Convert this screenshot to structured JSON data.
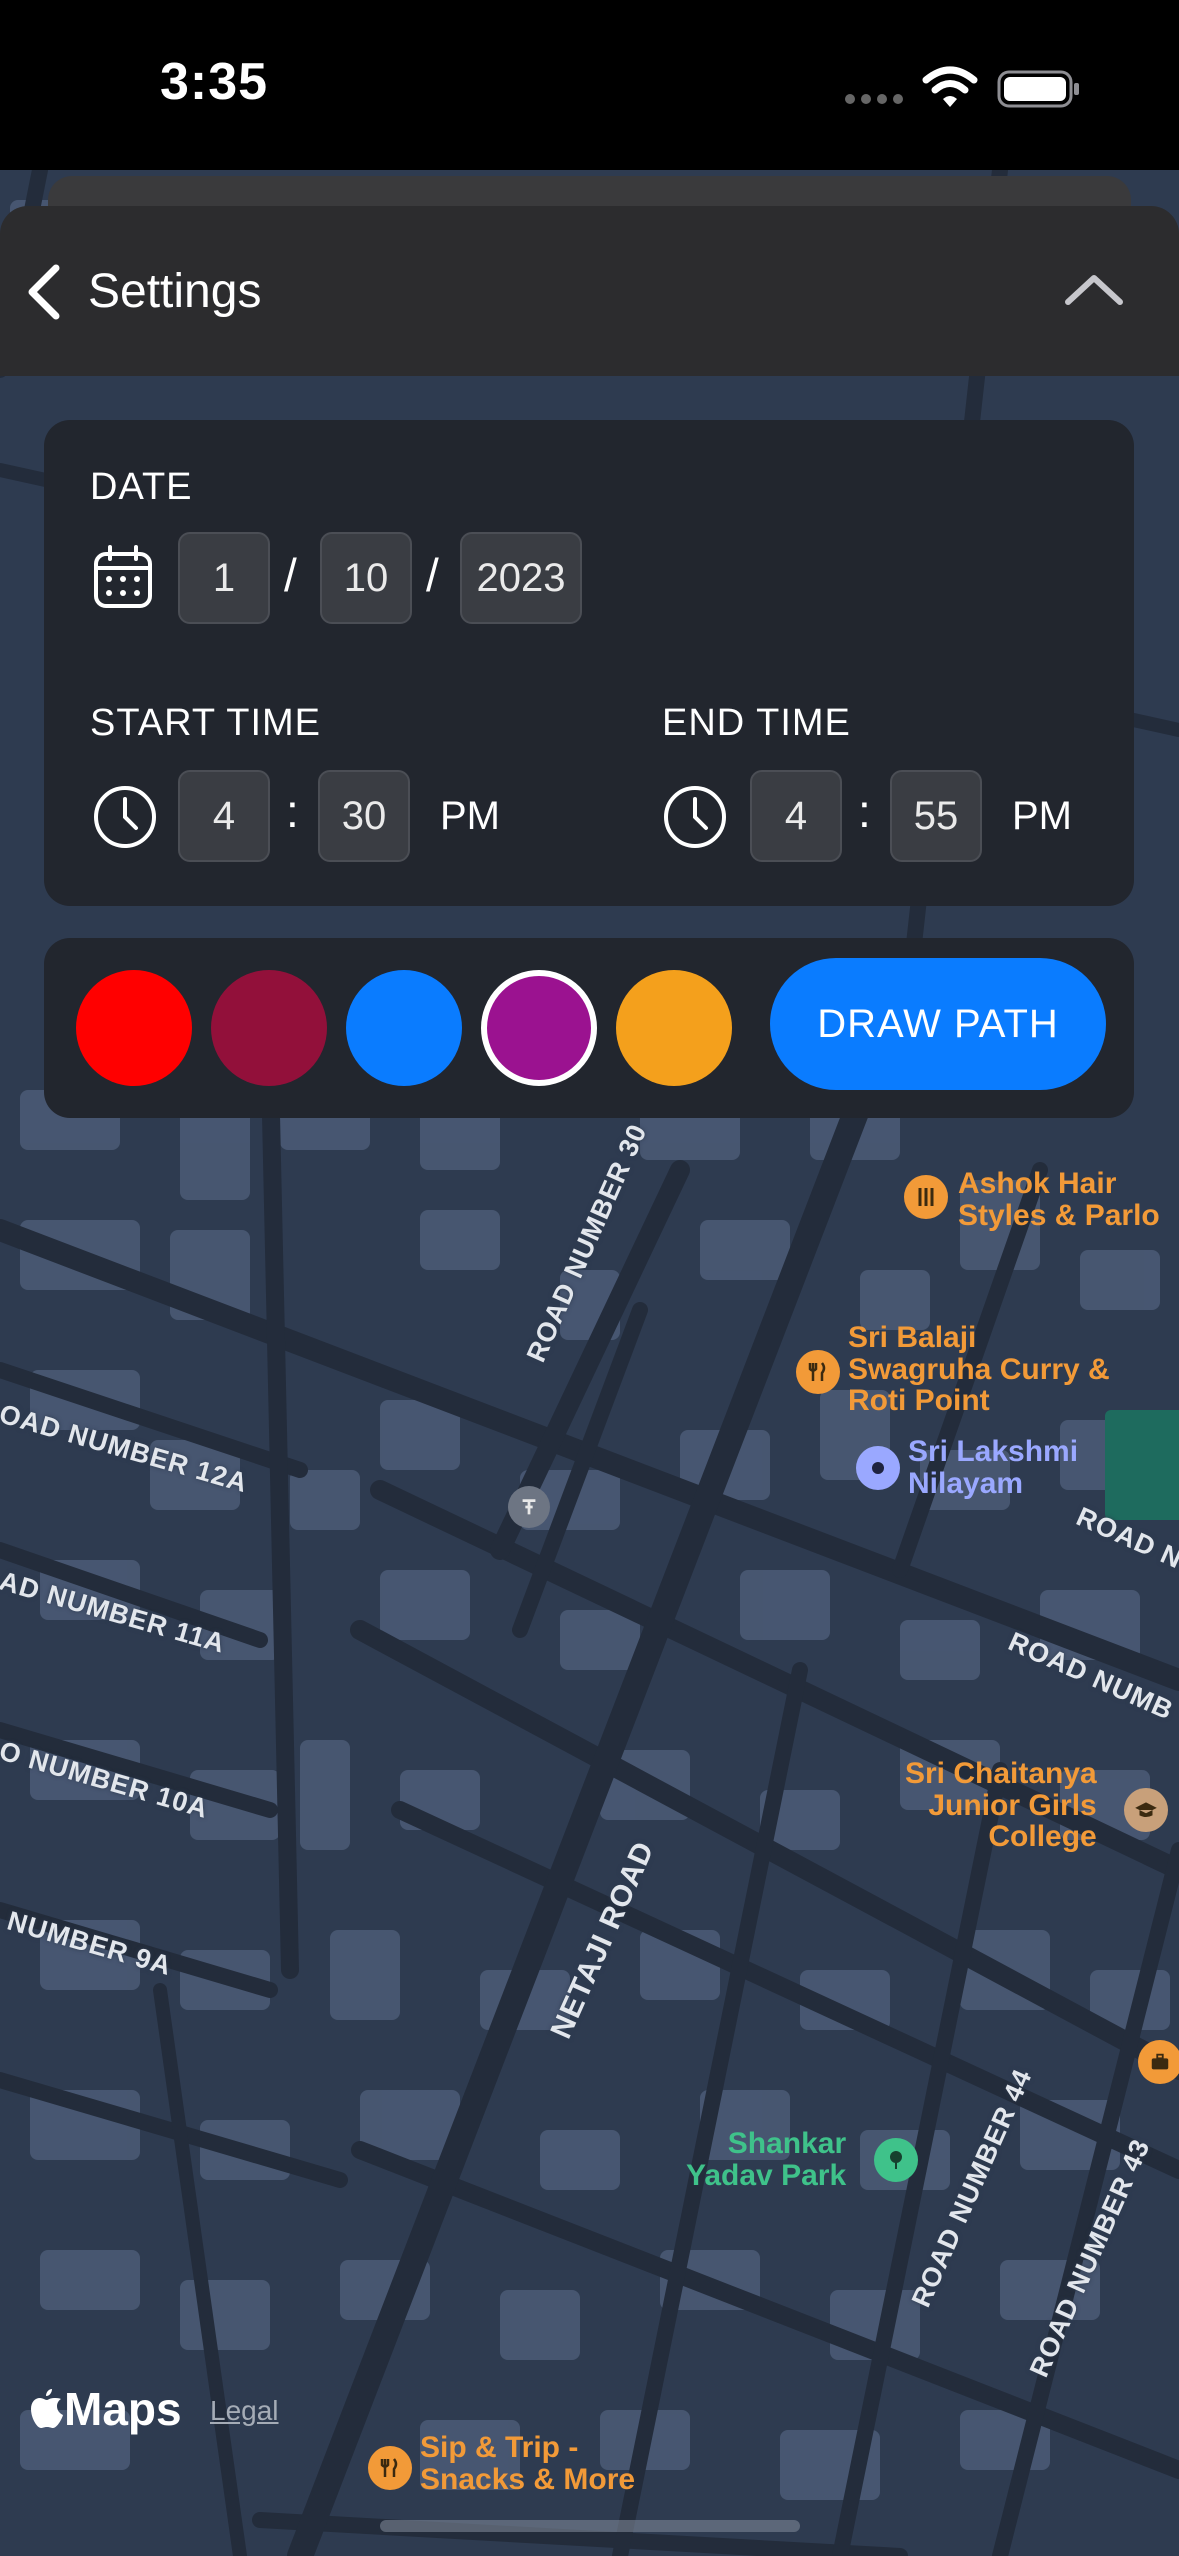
{
  "status_bar": {
    "time": "3:35"
  },
  "header": {
    "title": "Settings"
  },
  "date": {
    "label": "DATE",
    "month": "1",
    "day": "10",
    "year": "2023",
    "separator": "/"
  },
  "start_time": {
    "label": "START TIME",
    "hour": "4",
    "minute": "30",
    "separator": ":",
    "period": "PM"
  },
  "end_time": {
    "label": "END TIME",
    "hour": "4",
    "minute": "55",
    "separator": ":",
    "period": "PM"
  },
  "colors": {
    "swatches": [
      "#ff0000",
      "#92103a",
      "#0a7cff",
      "#9b1290",
      "#f4a01c"
    ],
    "selected_index": 3
  },
  "draw_path_label": "DRAW PATH",
  "map": {
    "attribution": "Maps",
    "legal": "Legal",
    "roads": [
      "ROAD NUMBER 30",
      "OAD NUMBER 12A",
      "AD NUMBER 11A",
      "O NUMBER 10A",
      "NUMBER 9A",
      "NETAJI ROAD",
      "ROAD NUMBER 44",
      "ROAD NUMBER 43",
      "ROAD NUMB",
      "ROAD N",
      "ROA",
      "OAD N"
    ],
    "pois": {
      "ashok": "Ashok Hair\nStyles & Parlo",
      "balaji": "Sri Balaji\nSwagruha Curry &\nRoti Point",
      "lakshmi": "Sri Lakshmi\nNilayam",
      "chaitanya": "Sri Chaitanya\nJunior Girls\nCollege",
      "shankar": "Shankar\nYadav Park",
      "sip": "Sip & Trip -\nSnacks & More"
    }
  }
}
